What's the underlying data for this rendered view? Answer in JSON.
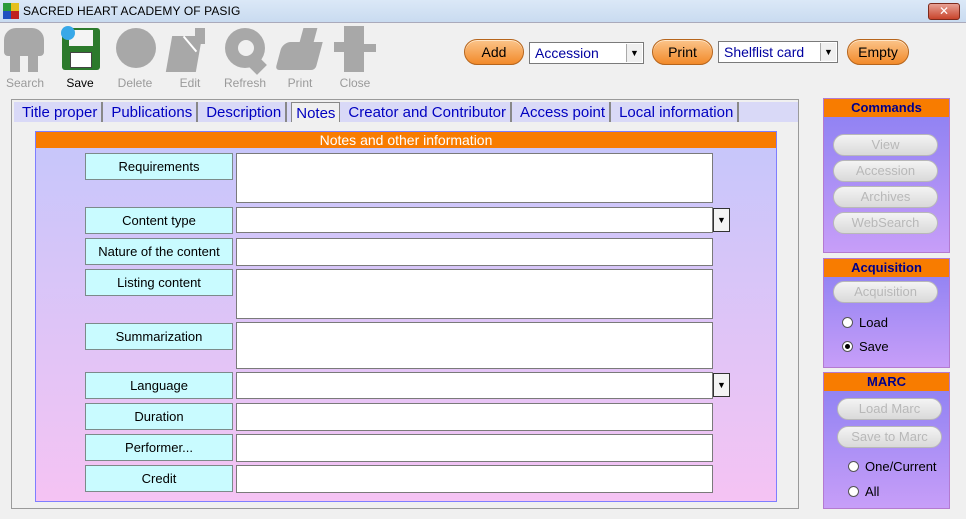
{
  "window": {
    "title": "SACRED HEART ACADEMY OF PASIG",
    "close_label": "✕"
  },
  "toolbar": {
    "buttons": [
      {
        "label": "Search",
        "icon": "search-icon",
        "enabled": false
      },
      {
        "label": "Save",
        "icon": "save-icon",
        "enabled": true
      },
      {
        "label": "Delete",
        "icon": "delete-icon",
        "enabled": false
      },
      {
        "label": "Edit",
        "icon": "edit-icon",
        "enabled": false
      },
      {
        "label": "Refresh",
        "icon": "refresh-icon",
        "enabled": false
      },
      {
        "label": "Print",
        "icon": "print-icon",
        "enabled": false
      },
      {
        "label": "Close",
        "icon": "close-icon",
        "enabled": false
      }
    ],
    "add_label": "Add",
    "add_combo_value": "Accession",
    "print_label": "Print",
    "print_combo_value": "Shelflist card",
    "empty_label": "Empty"
  },
  "tabs": [
    {
      "label": "Title proper",
      "selected": false
    },
    {
      "label": "Publications",
      "selected": false
    },
    {
      "label": "Description",
      "selected": false
    },
    {
      "label": "Notes",
      "selected": true
    },
    {
      "label": "Creator and Contributor",
      "selected": false
    },
    {
      "label": "Access point",
      "selected": false
    },
    {
      "label": "Local information",
      "selected": false
    }
  ],
  "form": {
    "header": "Notes and other information",
    "fields": [
      {
        "label": "Requirements",
        "value": "",
        "type": "textarea"
      },
      {
        "label": "Content type",
        "value": "",
        "type": "dropdown"
      },
      {
        "label": "Nature of the content",
        "value": "",
        "type": "text"
      },
      {
        "label": "Listing content",
        "value": "",
        "type": "textarea"
      },
      {
        "label": "Summarization",
        "value": "",
        "type": "textarea"
      },
      {
        "label": "Language",
        "value": "",
        "type": "dropdown"
      },
      {
        "label": "Duration",
        "value": "",
        "type": "text"
      },
      {
        "label": "Performer...",
        "value": "",
        "type": "text"
      },
      {
        "label": "Credit",
        "value": "",
        "type": "text"
      }
    ]
  },
  "commands": {
    "title": "Commands",
    "buttons": [
      "View",
      "Accession",
      "Archives",
      "WebSearch"
    ]
  },
  "acquisition": {
    "title": "Acquisition",
    "button": "Acquisition",
    "options": [
      {
        "label": "Load",
        "checked": false
      },
      {
        "label": "Save",
        "checked": true
      }
    ]
  },
  "marc": {
    "title": "MARC",
    "buttons": [
      "Load Marc",
      "Save to Marc"
    ],
    "options": [
      {
        "label": "One/Current",
        "checked": false
      },
      {
        "label": "All",
        "checked": false
      }
    ]
  },
  "colors": {
    "accent_orange": "#f87c00",
    "form_label_bg": "#c9fbff",
    "tab_text": "#0000c0"
  }
}
